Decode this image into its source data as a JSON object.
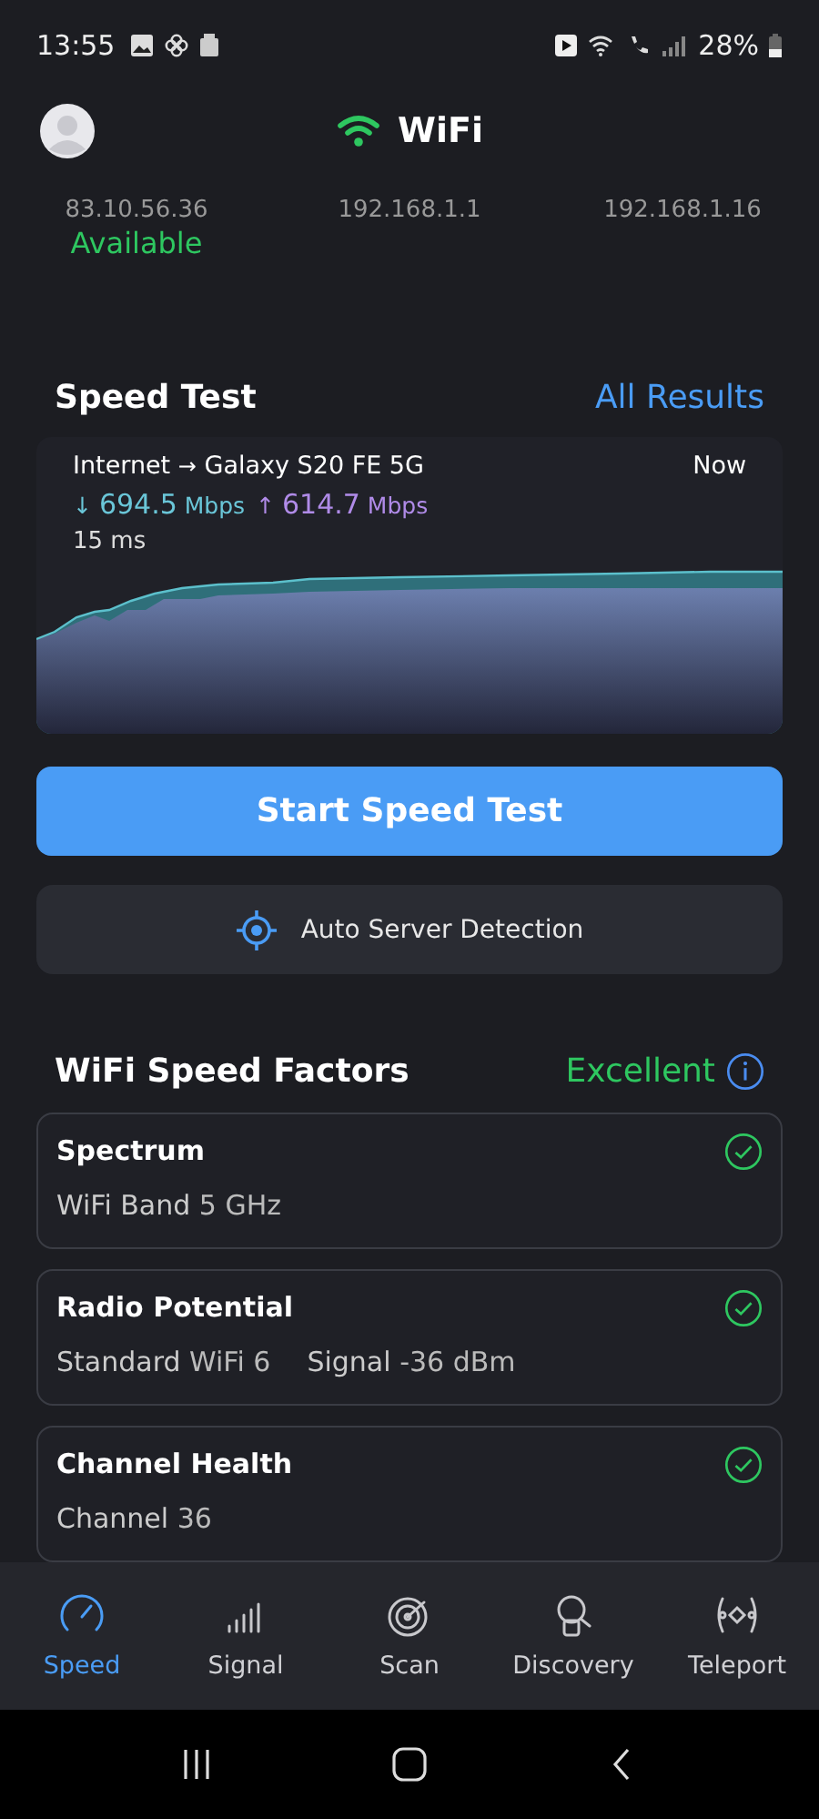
{
  "status_bar": {
    "time": "13:55",
    "battery": "28%"
  },
  "header": {
    "title": "WiFi"
  },
  "devices": [
    {
      "address": "83.10.56.36",
      "status": "Available"
    },
    {
      "address": "192.168.1.1"
    },
    {
      "address": "192.168.1.16"
    }
  ],
  "speed_test": {
    "title": "Speed Test",
    "link": "All Results",
    "route_from": "Internet",
    "route_arrow": "→",
    "route_to": "Galaxy S20 FE 5G",
    "time": "Now",
    "down_arrow": "↓",
    "down": "694.5",
    "down_unit": "Mbps",
    "up_arrow": "↑",
    "up": "614.7",
    "up_unit": "Mbps",
    "latency": "15 ms"
  },
  "start_button": "Start Speed Test",
  "server_button": "Auto Server Detection",
  "factors": {
    "title": "WiFi Speed Factors",
    "rating": "Excellent",
    "items": [
      {
        "title": "Spectrum",
        "ok": true,
        "details": [
          {
            "label": "WiFi Band",
            "value": "5 GHz"
          }
        ]
      },
      {
        "title": "Radio Potential",
        "ok": true,
        "details": [
          {
            "label": "Standard",
            "value": "WiFi 6"
          },
          {
            "label": "Signal",
            "value": "-36 dBm"
          }
        ]
      },
      {
        "title": "Channel Health",
        "ok": true,
        "details": [
          {
            "label": "Channel",
            "value": "36"
          }
        ]
      }
    ]
  },
  "tabs": [
    {
      "label": "Speed",
      "kind": "speed",
      "selected": true
    },
    {
      "label": "Signal",
      "kind": "signal",
      "selected": false
    },
    {
      "label": "Scan",
      "kind": "scan",
      "selected": false
    },
    {
      "label": "Discovery",
      "kind": "discovery",
      "selected": false
    },
    {
      "label": "Teleport",
      "kind": "teleport",
      "selected": false
    }
  ]
}
